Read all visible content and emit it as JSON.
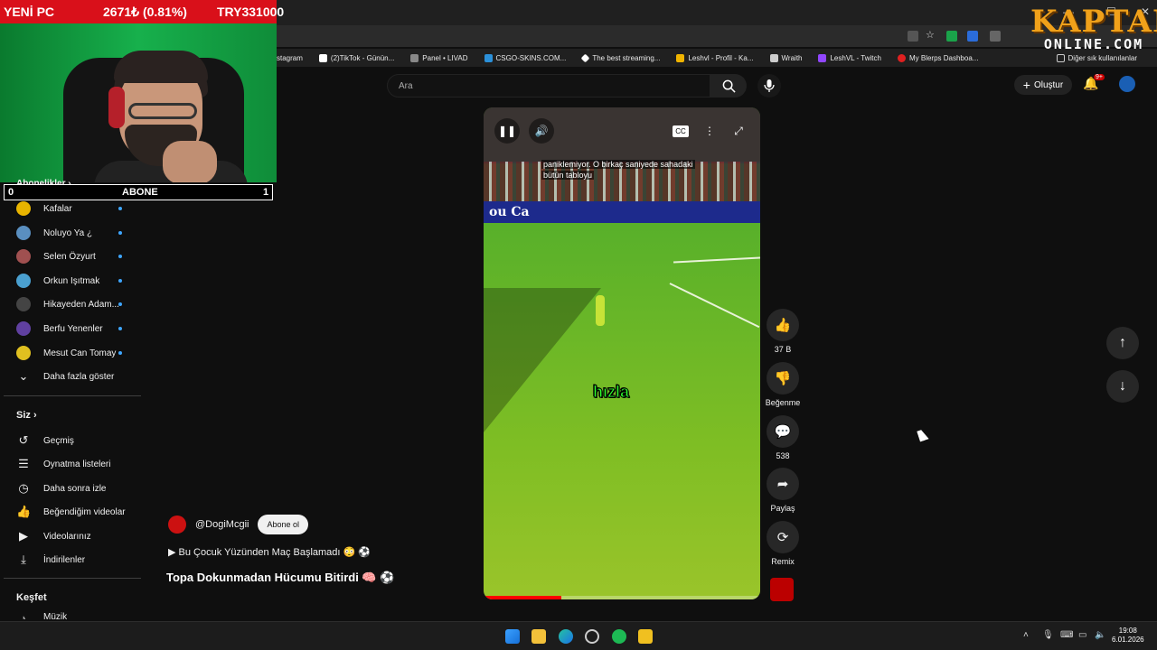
{
  "ticker": {
    "label": "YENİ PC",
    "change": "2671₺ (0.81%)",
    "total": "TRY331000"
  },
  "sub_counter": {
    "current": "0",
    "label": "ABONE",
    "goal": "1"
  },
  "logo": {
    "line1": "KAPTAN",
    "line2": "ONLINE.COM"
  },
  "bookmarks": [
    {
      "label": "stagram",
      "color": "#d6249f"
    },
    {
      "label": "(2)TikTok - Günün...",
      "color": "#ffffff"
    },
    {
      "label": "Panel • LIVAD",
      "color": "#888888"
    },
    {
      "label": "CSGO-SKINS.COM...",
      "color": "#2b90d9"
    },
    {
      "label": "The best streaming...",
      "color": "#ffffff"
    },
    {
      "label": "Leshvl - Profil - Ka...",
      "color": "#f0b400"
    },
    {
      "label": "Wraith",
      "color": "#cccccc"
    },
    {
      "label": "LeshVL - Twitch",
      "color": "#9146ff"
    },
    {
      "label": "My Blerps Dashboa...",
      "color": "#e02020"
    }
  ],
  "bookmarks_other": "Diğer sık kullanılanlar",
  "search": {
    "placeholder": "Ara"
  },
  "header": {
    "create_label": "Oluştur",
    "notif_badge": "9+"
  },
  "sidebar": {
    "subscriptions_title": "Abonelikler",
    "channels": [
      {
        "name": "Kafalar",
        "color": "#e8b400"
      },
      {
        "name": "Noluyo Ya ¿",
        "color": "#5a8fc0"
      },
      {
        "name": "Selen Özyurt",
        "color": "#a05050"
      },
      {
        "name": "Orkun Işıtmak",
        "color": "#4aa0d0"
      },
      {
        "name": "Hikayeden Adam...",
        "color": "#444444"
      },
      {
        "name": "Berfu Yenenler",
        "color": "#6040a0"
      },
      {
        "name": "Mesut Can Tomay",
        "color": "#e0c020"
      }
    ],
    "show_more": "Daha fazla göster",
    "you_title": "Siz",
    "you_items": [
      {
        "label": "Geçmiş",
        "icon": "history-icon",
        "glyph": "↺"
      },
      {
        "label": "Oynatma listeleri",
        "icon": "playlists-icon",
        "glyph": "☰"
      },
      {
        "label": "Daha sonra izle",
        "icon": "watch-later-icon",
        "glyph": "◷"
      },
      {
        "label": "Beğendiğim videolar",
        "icon": "liked-icon",
        "glyph": "👍"
      },
      {
        "label": "Videolarınız",
        "icon": "your-videos-icon",
        "glyph": "▶"
      },
      {
        "label": "İndirilenler",
        "icon": "downloads-icon",
        "glyph": "⤓"
      }
    ],
    "explore_title": "Keşfet",
    "explore_partial": "Müzik"
  },
  "video": {
    "caption": "paniklemiyor. O birkaç saniyede sahadaki bütün tabloyu",
    "overlay_text": "hızla",
    "board_text": "ou Ca",
    "progress": 0.28
  },
  "actions": {
    "likes": "37 B",
    "dislike_label": "Beğenme",
    "comments": "538",
    "share_label": "Paylaş",
    "remix_label": "Remix"
  },
  "channel": {
    "handle": "@DogiMcgii",
    "subscribe_label": "Abone ol",
    "playlist": "▶ Bu Çocuk Yüzünden Maç Başlamadı 😳 ⚽",
    "title": "Topa Dokunmadan Hücumu Bitirdi 🧠 ⚽"
  },
  "clock": {
    "time": "19:08",
    "date": "6.01.2026"
  }
}
